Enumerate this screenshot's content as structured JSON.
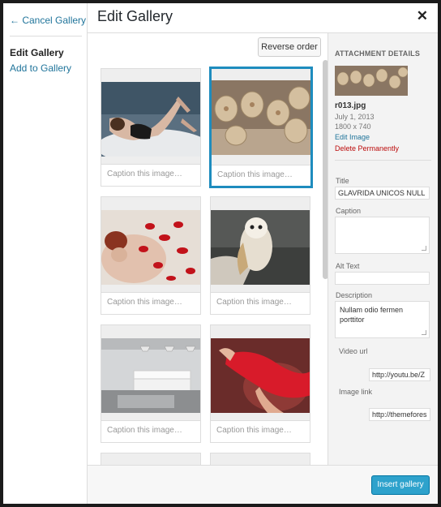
{
  "menu": {
    "cancel_label": "← Cancel Gallery",
    "edit_label": "Edit Gallery",
    "add_label": "Add to Gallery"
  },
  "header": {
    "title": "Edit Gallery",
    "close_glyph": "✕"
  },
  "toolbar": {
    "reverse_label": "Reverse order"
  },
  "gallery": {
    "caption_placeholder": "Caption this image…",
    "items": [
      {
        "caption": "Caption this image…"
      },
      {
        "caption": "Caption this image…"
      },
      {
        "caption": "Caption this image…"
      },
      {
        "caption": "Caption this image…"
      },
      {
        "caption": "Caption this image…"
      },
      {
        "caption": "Caption this image…"
      }
    ]
  },
  "details": {
    "heading": "ATTACHMENT DETAILS",
    "filename": "r013.jpg",
    "date": "July 1, 2013",
    "dimensions": "1800 x 740",
    "edit_link": "Edit Image",
    "delete_link": "Delete Permanently",
    "title_label": "Title",
    "title_value": "GLAVRIDA UNICOS NULL",
    "caption_label": "Caption",
    "caption_value": "",
    "alt_label": "Alt Text",
    "alt_value": "",
    "description_label": "Description",
    "description_value": "Nullam odio fermen porttitor",
    "video_label": "Video url",
    "video_value": "http://youtu.be/Z",
    "imagelink_label": "Image link",
    "imagelink_value": "http://themefores"
  },
  "footer": {
    "insert_label": "Insert gallery"
  },
  "colors": {
    "accent": "#2ea2cc",
    "link": "#21759b",
    "danger": "#bc0b0b",
    "selected_border": "#1e8cbe"
  }
}
